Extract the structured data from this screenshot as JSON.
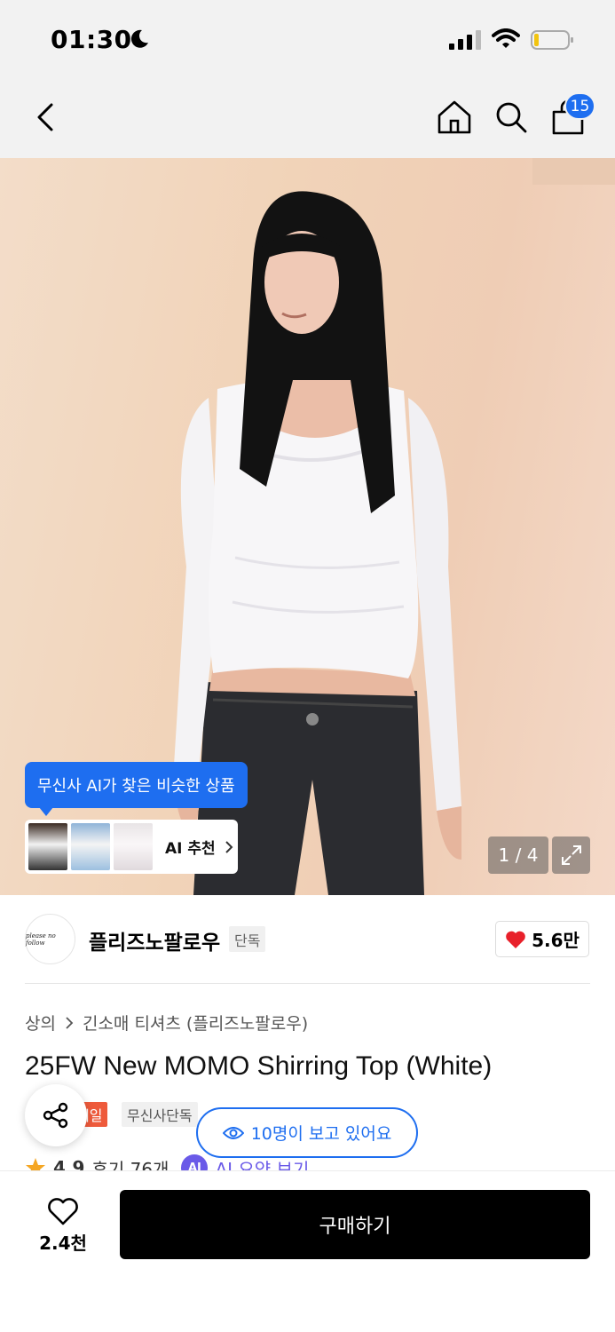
{
  "status_bar": {
    "time": "01:30"
  },
  "nav": {
    "cart_count": "15"
  },
  "hero": {
    "ai_tooltip": "무신사 AI가 찾은 비슷한 상품",
    "ai_reco_label": "AI 추천",
    "page_indicator": "1 / 4"
  },
  "brand": {
    "name": "플리즈노팔로우",
    "exclusive_tag": "단독",
    "like_count": "5.6만",
    "logo_text": "please no follow"
  },
  "breadcrumb": {
    "category": "상의",
    "subcategory": "긴소매 티셔츠 (플리즈노팔로우)"
  },
  "product": {
    "title": "25FW New MOMO Shirring Top (White)",
    "sale_tag": "세일",
    "exclusive_tag": "무신사단독",
    "viewers": "10명이 보고 있어요",
    "rating": "4.9",
    "reviews": "후기 76개",
    "ai_badge": "AI",
    "ai_summary": "AI 요약 보기"
  },
  "bottom_bar": {
    "wish_count": "2.4천",
    "buy_label": "구매하기"
  },
  "colors": {
    "accent_blue": "#1e6ef0",
    "sale_red": "#ee5a3b",
    "ai_purple": "#6a5ae8",
    "buy_black": "#000000"
  }
}
